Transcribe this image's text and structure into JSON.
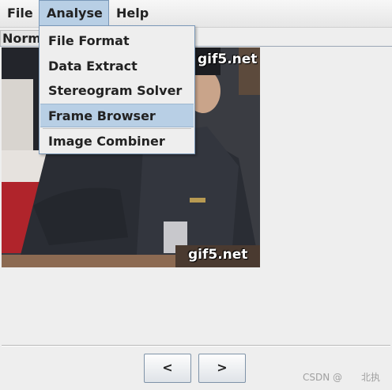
{
  "menubar": {
    "items": [
      {
        "label": "File"
      },
      {
        "label": "Analyse"
      },
      {
        "label": "Help"
      }
    ]
  },
  "tab": {
    "label": "Norm"
  },
  "dropdown": {
    "items": [
      {
        "label": "File Format"
      },
      {
        "label": "Data Extract"
      },
      {
        "label": "Stereogram Solver"
      },
      {
        "label": "Frame Browser"
      },
      {
        "label": "Image Combiner"
      }
    ],
    "highlighted": "Frame Browser"
  },
  "image": {
    "watermark_top": "gif5.net",
    "watermark_bottom": "gif5.net"
  },
  "buttons": {
    "prev_label": "<",
    "next_label": ">"
  },
  "credit": "CSDN @　　北执",
  "colors": {
    "menu_highlight": "#b8cfe5",
    "background": "#eeeeee",
    "border_accent": "#7a98b8"
  }
}
